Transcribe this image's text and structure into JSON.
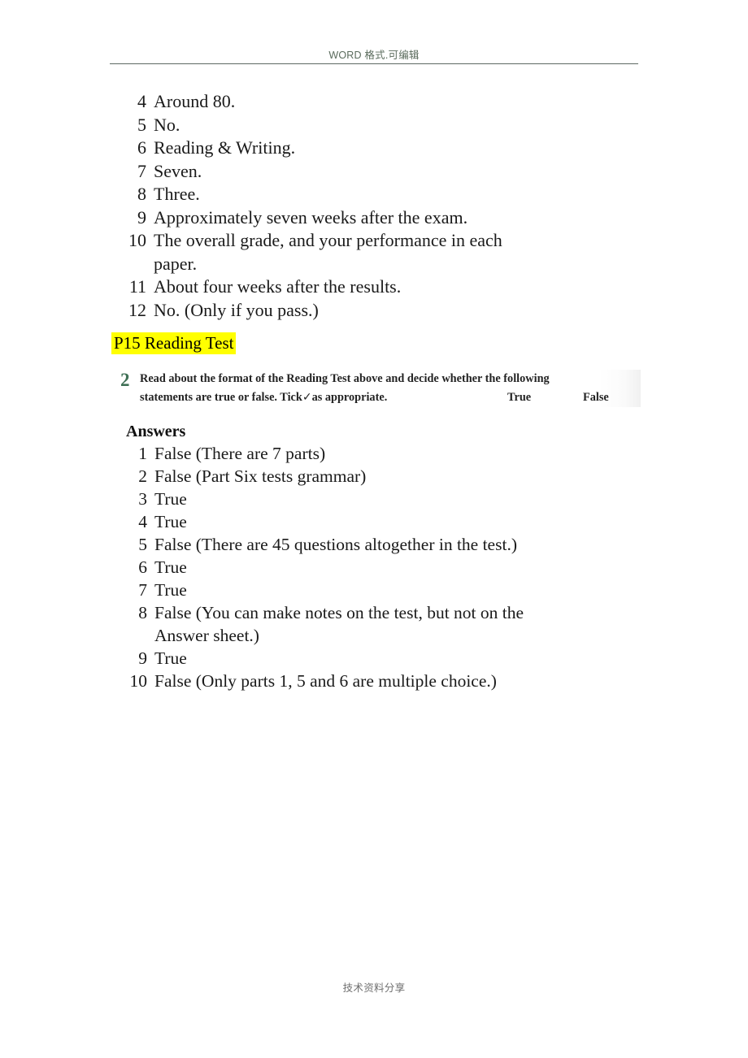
{
  "header": {
    "text": "WORD 格式.可编辑"
  },
  "footer": {
    "text": "技术资料分享"
  },
  "top_answers": {
    "items": [
      {
        "num": "4",
        "text": "Around 80."
      },
      {
        "num": "5",
        "text": "No."
      },
      {
        "num": "6",
        "text": "Reading & Writing."
      },
      {
        "num": "7",
        "text": "Seven."
      },
      {
        "num": "8",
        "text": "Three."
      },
      {
        "num": "9",
        "text": "Approximately seven weeks after the exam."
      },
      {
        "num": "10",
        "text": "The overall grade, and your performance in each paper."
      },
      {
        "num": "11",
        "text": "About four weeks after the results."
      },
      {
        "num": "12",
        "text": "No. (Only if you pass.)"
      }
    ]
  },
  "section": {
    "heading": "P15 Reading Test",
    "highlight_color": "#ffff00"
  },
  "exercise": {
    "number": "2",
    "number_color": "#3f7055",
    "line1": "Read about the format of the Reading Test above and decide whether the following",
    "line2_prefix": "statements are true or false. Tick ",
    "tick_glyph": "✓",
    "line2_suffix": " as appropriate.",
    "col_true": "True",
    "col_false": "False"
  },
  "answers": {
    "heading": "Answers",
    "items": [
      {
        "num": "1",
        "text": "False (There are 7 parts)"
      },
      {
        "num": "2",
        "text": "False (Part Six tests grammar)"
      },
      {
        "num": "3",
        "text": "True"
      },
      {
        "num": "4",
        "text": "True"
      },
      {
        "num": "5",
        "text": "False (There are 45 questions altogether in the test.)"
      },
      {
        "num": "6",
        "text": "True"
      },
      {
        "num": "7",
        "text": "True"
      },
      {
        "num": "8",
        "text": "False (You can make notes on the test, but not on the Answer sheet.)"
      },
      {
        "num": "9",
        "text": "True"
      },
      {
        "num": "10",
        "text": "False (Only parts 1, 5 and 6 are multiple choice.)"
      }
    ]
  }
}
